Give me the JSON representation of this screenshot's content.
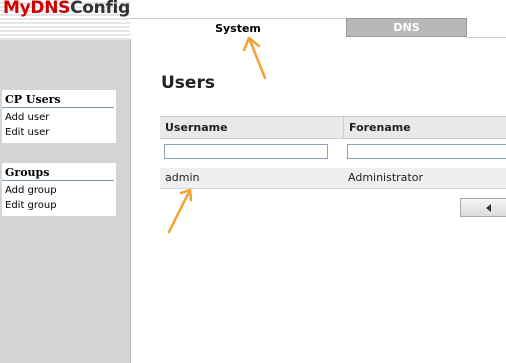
{
  "app": {
    "logo_part1": "MyDNS",
    "logo_part2": "Config"
  },
  "sidebar": {
    "sections": [
      {
        "title": "CP Users",
        "items": [
          "Add user",
          "Edit user"
        ]
      },
      {
        "title": "Groups",
        "items": [
          "Add group",
          "Edit group"
        ]
      }
    ]
  },
  "tabs": [
    {
      "label": "System",
      "active": true
    },
    {
      "label": "DNS",
      "active": false
    }
  ],
  "main": {
    "title": "Users",
    "table": {
      "columns": [
        "Username",
        "Forename"
      ],
      "filters": [
        "",
        ""
      ],
      "rows": [
        [
          "admin",
          "Administrator"
        ]
      ]
    },
    "pager": {
      "prev_icon": "triangle-left-icon"
    }
  },
  "colors": {
    "logo_red": "#cc0000",
    "sidebar_bg": "#d4d4d4",
    "annotation_arrow": "#f5a030"
  }
}
